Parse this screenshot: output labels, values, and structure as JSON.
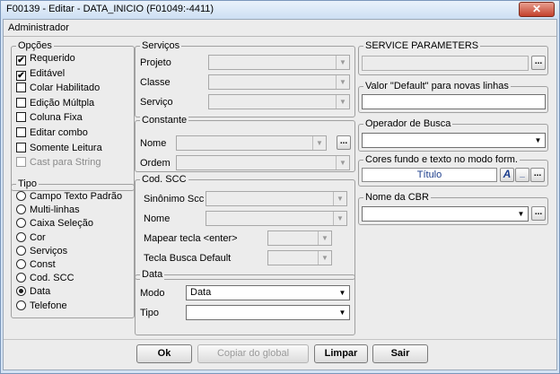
{
  "window": {
    "title": "F00139 - Editar - DATA_INICIO (F01049:-4411)",
    "close_glyph": "✕"
  },
  "menubar": {
    "label": "Administrador"
  },
  "opcoes": {
    "legend": "Opções",
    "items": [
      {
        "label": "Requerido",
        "checked": true,
        "enabled": true
      },
      {
        "label": "Editável",
        "checked": true,
        "enabled": true
      },
      {
        "label": "Colar Habilitado",
        "checked": false,
        "enabled": true
      },
      {
        "label": "Edição Múltpla",
        "checked": false,
        "enabled": true
      },
      {
        "label": "Coluna Fixa",
        "checked": false,
        "enabled": true
      },
      {
        "label": "Editar combo",
        "checked": false,
        "enabled": true
      },
      {
        "label": "Somente Leitura",
        "checked": false,
        "enabled": true
      },
      {
        "label": "Cast para String",
        "checked": false,
        "enabled": false
      }
    ]
  },
  "tipo": {
    "legend": "Tipo",
    "selected": "Data",
    "items": [
      "Campo Texto Padrão",
      "Multi-linhas",
      "Caixa Seleção",
      "Cor",
      "Serviços",
      "Const",
      "Cod. SCC",
      "Data",
      "Telefone"
    ]
  },
  "servicos": {
    "legend": "Serviços",
    "projeto": "Projeto",
    "classe": "Classe",
    "servico": "Serviço"
  },
  "constante": {
    "legend": "Constante",
    "nome": "Nome",
    "ordem": "Ordem",
    "ellipsis": "..."
  },
  "cod_scc": {
    "legend": "Cod. SCC",
    "sinonimo": "Sinônimo Scc",
    "nome": "Nome",
    "mapear": "Mapear tecla <enter>",
    "tecla_busca": "Tecla Busca Default"
  },
  "data_group": {
    "legend": "Data",
    "modo_label": "Modo",
    "modo_value": "Data",
    "tipo_label": "Tipo",
    "tipo_value": ""
  },
  "service_parameters": {
    "legend": "SERVICE PARAMETERS",
    "value": "",
    "ellipsis": "..."
  },
  "valor_default": {
    "legend": "Valor \"Default\" para novas linhas",
    "value": ""
  },
  "operador_busca": {
    "legend": "Operador de Busca",
    "value": ""
  },
  "cores": {
    "legend": "Cores fundo e texto no modo form.",
    "sample": "Título",
    "font_btn": "A",
    "underline_btn": "_",
    "more_btn": "..."
  },
  "nome_cbr": {
    "legend": "Nome da CBR",
    "value": "",
    "ellipsis": "..."
  },
  "buttons": {
    "ok": "Ok",
    "copiar": "Copiar do global",
    "limpar": "Limpar",
    "sair": "Sair"
  }
}
